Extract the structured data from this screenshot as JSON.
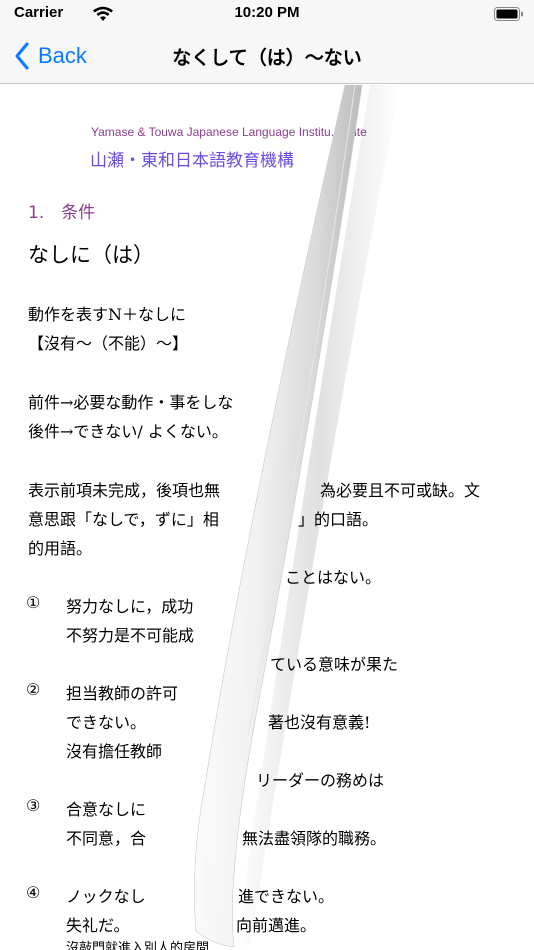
{
  "status": {
    "carrier": "Carrier",
    "time": "10:20 PM"
  },
  "nav": {
    "back_label": "Back",
    "title": "なくして（は）〜ない"
  },
  "institute": {
    "en": "Yamase & Touwa Japanese Language Institu... itute",
    "ja": "山瀬・東和日本語教育機構"
  },
  "section": "1.　条件",
  "heading": "なしに（は）",
  "lines": [
    "動作を表すN＋なしに",
    "【沒有〜（不能）〜】",
    "前件→必要な動作・事をしな",
    "後件→できない/ よくない。",
    "表示前項未完成，後項也無",
    "為必要且不可或缺。文",
    "意思跟「なしで，ずに」相",
    "」的口語。",
    "的用語。",
    "ことはない。",
    "努力なしに，成功",
    "不努力是不可能成",
    "ている意味が果た",
    "担当教師の許可",
    "できない。",
    "著也沒有意義!",
    "沒有擔任教師",
    "リーダーの務めは",
    "合意なしに",
    "不同意，合",
    "無法盡領隊的職務。",
    "ノックなし",
    "進できない。",
    "失礼だ。",
    "向前邁進。",
    "沒敲門就進入別人的房間"
  ],
  "numbers": [
    "①",
    "②",
    "③",
    "④"
  ]
}
